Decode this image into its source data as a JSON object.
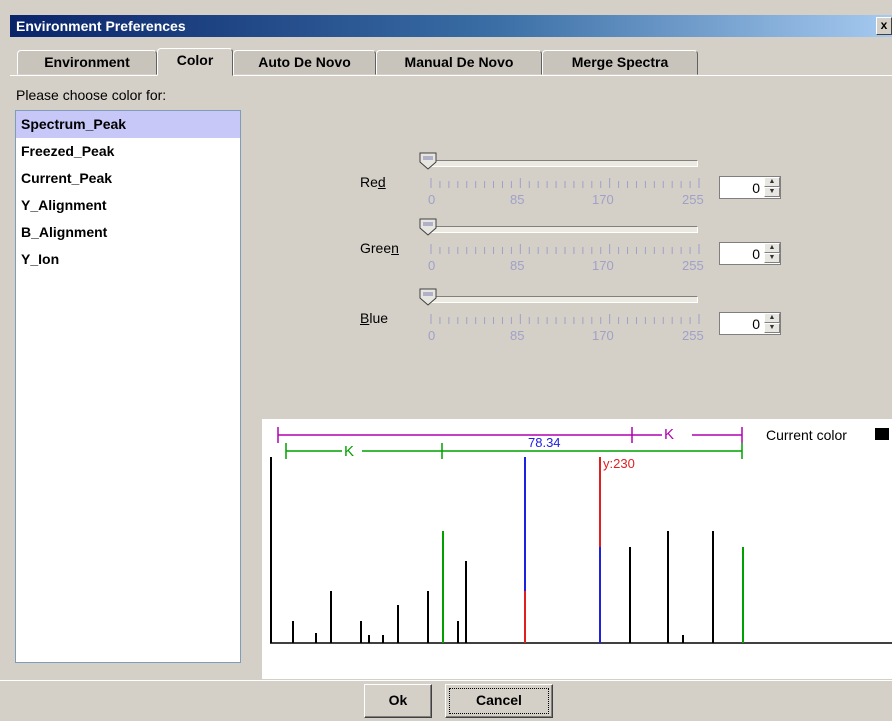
{
  "window": {
    "title": "Environment Preferences",
    "close_glyph": "x"
  },
  "tabs": [
    {
      "label": "Environment",
      "active": false
    },
    {
      "label": "Color",
      "active": true
    },
    {
      "label": "Auto De Novo",
      "active": false
    },
    {
      "label": "Manual De Novo",
      "active": false
    },
    {
      "label": "Merge Spectra",
      "active": false
    }
  ],
  "color_panel": {
    "prompt": "Please choose color for:",
    "items": [
      "Spectrum_Peak",
      "Freezed_Peak",
      "Current_Peak",
      "Y_Alignment",
      "B_Alignment",
      "Y_Ion"
    ],
    "selected_item": "Spectrum_Peak",
    "sliders": [
      {
        "label_before": "Re",
        "mnemonic": "d",
        "label_after": "",
        "value": "0",
        "level": 0
      },
      {
        "label_before": "Gree",
        "mnemonic": "n",
        "label_after": "",
        "value": "0",
        "level": 0
      },
      {
        "label_before": "",
        "mnemonic": "B",
        "label_after": "lue",
        "value": "0",
        "level": 0
      }
    ],
    "tick_labels": [
      "0",
      "85",
      "170",
      "255"
    ],
    "slider_max": 255
  },
  "preview": {
    "current_color_label": "Current color",
    "current_color": "#000000",
    "annotation_k_top": "K",
    "annotation_k_bottom": "K",
    "annotation_mass": "78.34",
    "annotation_ion": "y:230",
    "colors": {
      "magenta": "#b000b0",
      "green": "#00a000",
      "blue": "#2020e0",
      "red": "#e02020",
      "black": "#000000"
    }
  },
  "buttons": {
    "ok": "Ok",
    "cancel": "Cancel"
  }
}
